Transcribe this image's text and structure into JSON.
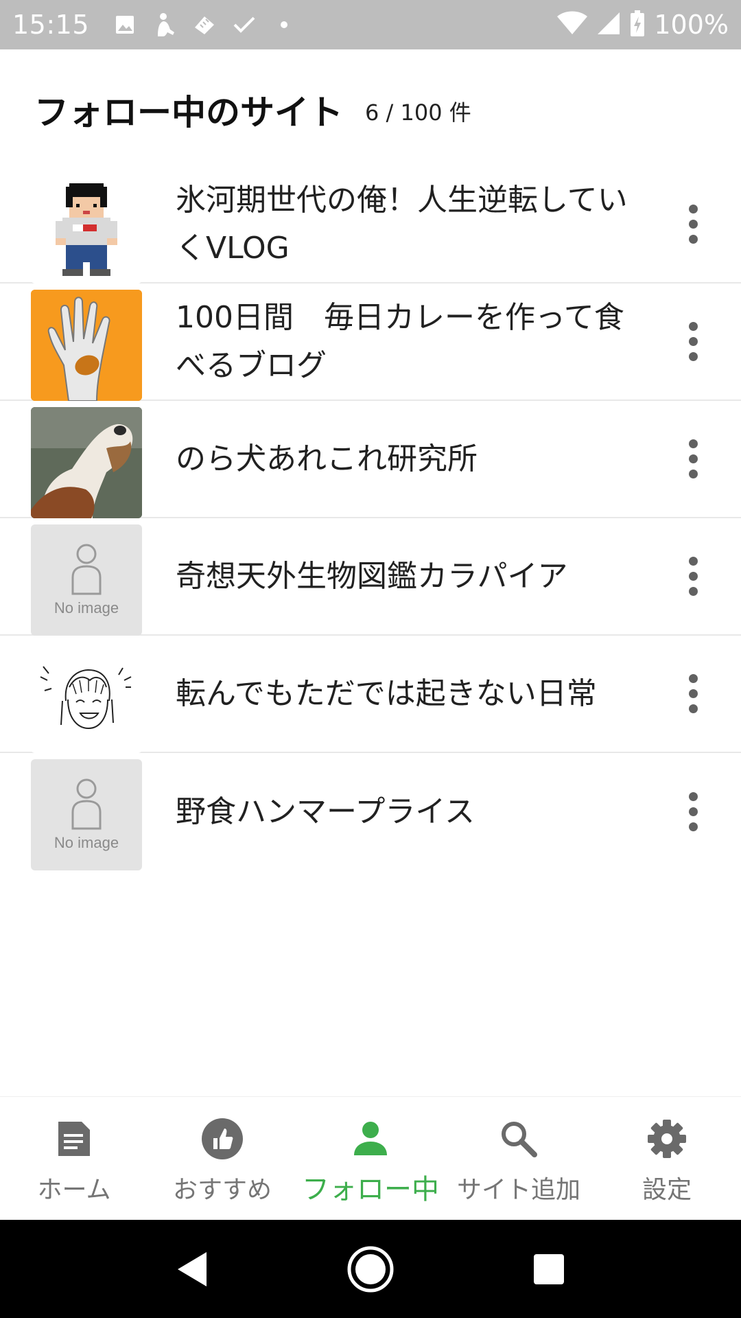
{
  "status_bar": {
    "time": "15:15",
    "battery": "100%",
    "icons_left": [
      "image-icon",
      "person-icon",
      "ruler-icon",
      "check-icon",
      "dot-icon"
    ],
    "icons_right": [
      "wifi-icon",
      "signal-icon",
      "battery-charging-icon"
    ]
  },
  "header": {
    "title": "フォロー中のサイト",
    "count": "6 / 100 件"
  },
  "sites": [
    {
      "name": "氷河期世代の俺！人生逆転していくVLOG",
      "thumbnail": "pixel-avatar"
    },
    {
      "name": "100日間　毎日カレーを作って食べるブログ",
      "thumbnail": "hand-photo"
    },
    {
      "name": "のら犬あれこれ研究所",
      "thumbnail": "dog-photo"
    },
    {
      "name": "奇想天外生物図鑑カラパイア",
      "thumbnail": "no-image",
      "thumbnail_label": "No image"
    },
    {
      "name": "転んでもただでは起きない日常",
      "thumbnail": "sketch-face"
    },
    {
      "name": "野食ハンマープライス",
      "thumbnail": "no-image",
      "thumbnail_label": "No image"
    }
  ],
  "bottom_nav": [
    {
      "label": "ホーム",
      "icon": "document-icon",
      "active": false
    },
    {
      "label": "おすすめ",
      "icon": "thumbs-up-icon",
      "active": false
    },
    {
      "label": "フォロー中",
      "icon": "person-icon",
      "active": true
    },
    {
      "label": "サイト追加",
      "icon": "search-icon",
      "active": false
    },
    {
      "label": "設定",
      "icon": "gear-icon",
      "active": false
    }
  ],
  "colors": {
    "accent": "#3dae4c",
    "inactive": "#757575",
    "status_bar": "#bdbdbd"
  }
}
